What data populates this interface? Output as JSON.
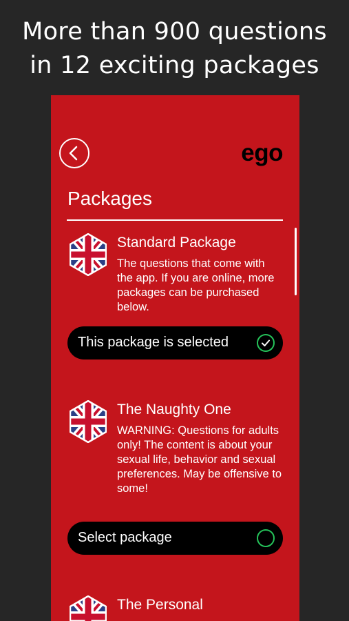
{
  "headline": {
    "line1": "More than 900 questions",
    "line2": "in 12 exciting packages"
  },
  "app": {
    "logo": "ego",
    "title": "Packages",
    "back_icon": "chevron-left-icon",
    "accent_color": "#c4151c",
    "check_color": "#25c35a"
  },
  "packages": [
    {
      "name": "Standard Package",
      "description": "The questions that come with the app. If you are online, more packages can be purchased below.",
      "button_label": "This package is selected",
      "selected": true,
      "icon": "uk-flag-hexagon-icon"
    },
    {
      "name": "The Naughty One",
      "description": "WARNING: Questions for adults only! The content is about your sexual life, behavior and sexual preferences. May be offensive to some!",
      "button_label": "Select package",
      "selected": false,
      "icon": "uk-flag-hexagon-icon"
    },
    {
      "name": "The Personal",
      "description": "",
      "button_label": "",
      "selected": false,
      "icon": "uk-flag-hexagon-icon"
    }
  ]
}
